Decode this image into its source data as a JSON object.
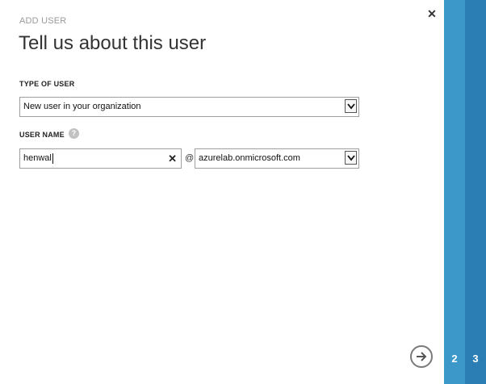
{
  "dialog": {
    "eyebrow": "ADD USER",
    "title": "Tell us about this user",
    "close_icon": "close-icon"
  },
  "type_of_user": {
    "label": "TYPE OF USER",
    "selected": "New user in your organization"
  },
  "user_name": {
    "label": "USER NAME",
    "help_glyph": "?",
    "value": "henwal",
    "clear_glyph": "✕",
    "at": "@",
    "domain_selected": "azurelab.onmicrosoft.com"
  },
  "steps": {
    "step2": "2",
    "step3": "3"
  },
  "colors": {
    "rail_light": "#3c98c9",
    "rail_dark": "#2a7eb4"
  }
}
